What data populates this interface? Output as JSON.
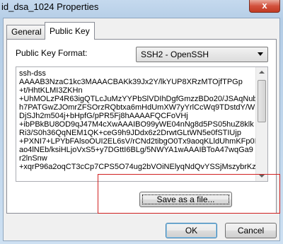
{
  "window": {
    "title": "id_dsa_1024 Properties",
    "close_label": "x"
  },
  "tabs": [
    {
      "label": "General",
      "active": false
    },
    {
      "label": "Public Key",
      "active": true
    }
  ],
  "key_format": {
    "label": "Public Key Format:",
    "selected": "SSH2 - OpenSSH"
  },
  "key_text": "ssh-dss\nAAAAB3NzaC1kc3MAAACBAKk39Jx2Y/lkYUP8XRzMTOjfTPGp\n+t/HhtKLMI3ZKHn\n+UhMOLzP4R63igQTLcJuMzYYPbSlVDIhDgfGmzzBDo20/JSAqNub\nh7PATGwZJOmrZFSOrzRQbtxa6mHdUmXW7yYrlCcWq9TDstdY/W\nDjSJh2m504j+bHpfG/pPR5Fj8hAAAAFQCFoVHj\n+ibPBkBU8OD9qJ47M4cXwAAAIBO99yWE04nNg8d5PS05huZ8klk\nRi3/S0h36QqNEM1QK+ceG9h9JDdx6z2DrwtGLtWN5e0fSTIUjp\n+PXNI7+LPYbFAlsoOUI2EL6sV/rCNd2tibgO0Tx9aoqKLldUhmKFp0IG\nao4lNEb/ksiHLjoVxS5+y7DGttI6BLg/5NWYA1wAAAIBToA47wqGa9\nr2lnSnw\n+xqrP96a2oqCT3cCp7CPS5O74ug2bVOiNElyqNdQvYSSjMszybrKzgf",
  "buttons": {
    "save": "Save as a file...",
    "ok": "OK",
    "cancel": "Cancel"
  }
}
